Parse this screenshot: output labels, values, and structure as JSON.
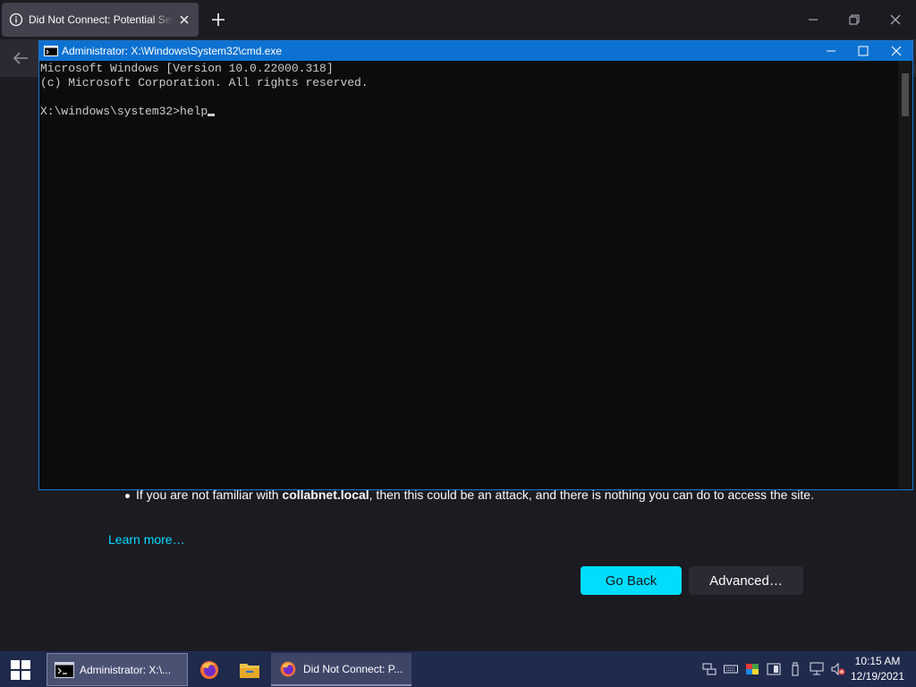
{
  "browser": {
    "tab_title": "Did Not Connect: Potential Security Issue"
  },
  "error_page": {
    "bullet_prefix": "If you are not familiar with ",
    "bullet_host": "collabnet.local",
    "bullet_suffix": ", then this could be an attack, and there is nothing you can do to access the site.",
    "learn_more": "Learn more…",
    "go_back": "Go Back",
    "advanced": "Advanced…",
    "colors": {
      "accent": "#00ddff",
      "background": "#1c1b22"
    }
  },
  "cmd": {
    "title": "Administrator: X:\\Windows\\System32\\cmd.exe",
    "line1": "Microsoft Windows [Version 10.0.22000.318]",
    "line2": "(c) Microsoft Corporation. All rights reserved.",
    "prompt": "X:\\windows\\system32>",
    "input": "help",
    "colors": {
      "titlebar": "#0c71d1",
      "console_bg": "#0c0c0c"
    }
  },
  "taskbar": {
    "cmd_label": "Administrator: X:\\...",
    "firefox_label": "Did Not Connect: P...",
    "time": "10:15 AM",
    "date": "12/19/2021"
  }
}
